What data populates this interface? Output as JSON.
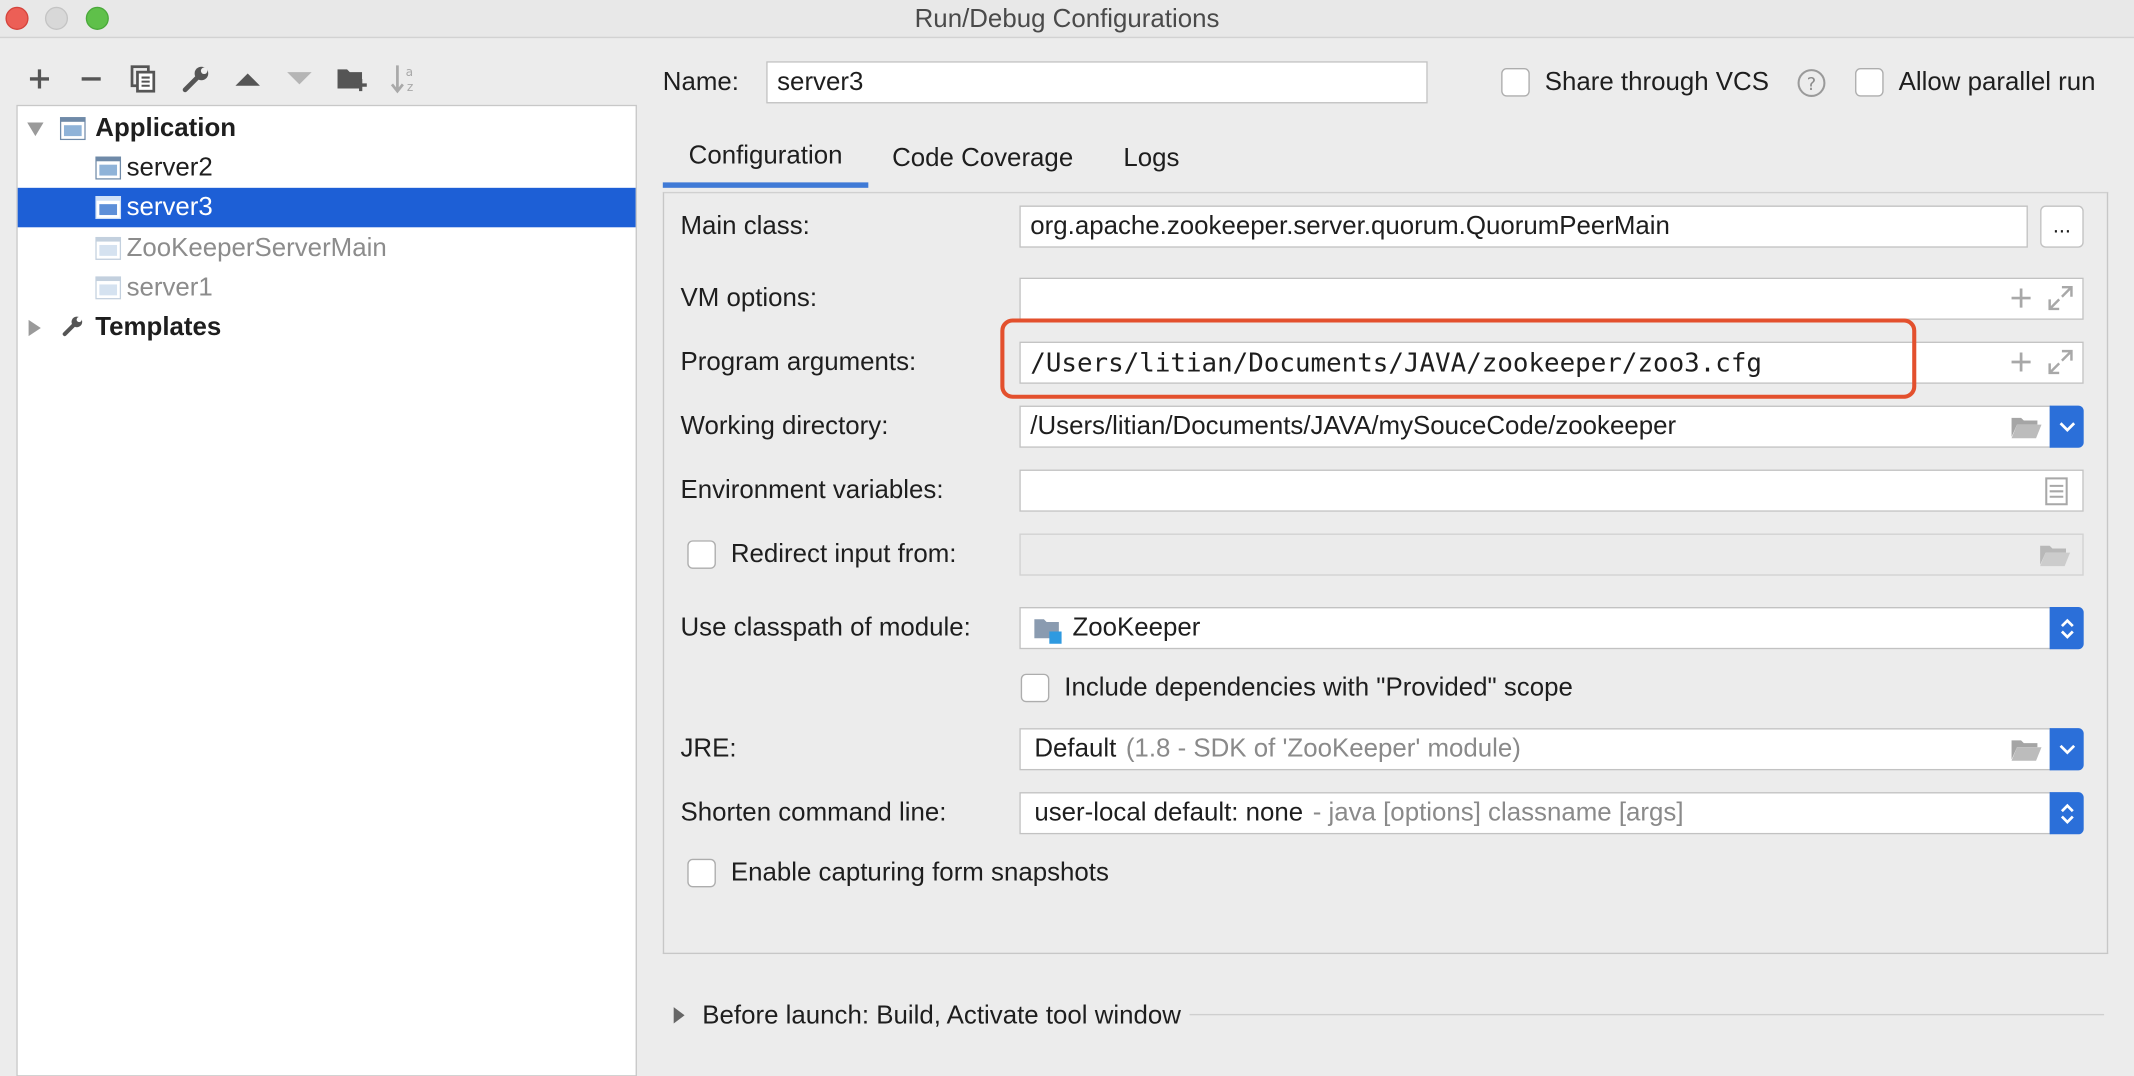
{
  "window": {
    "title": "Run/Debug Configurations"
  },
  "toolbar": {
    "buttons": [
      "add-icon",
      "remove-icon",
      "copy-icon",
      "wrench-icon",
      "move-up-icon",
      "move-down-icon",
      "folder-add-icon",
      "sort-icon"
    ]
  },
  "tree": {
    "group_label": "Application",
    "items": [
      {
        "label": "server2",
        "selected": false,
        "dim": false
      },
      {
        "label": "server3",
        "selected": true,
        "dim": false
      },
      {
        "label": "ZooKeeperServerMain",
        "selected": false,
        "dim": true
      },
      {
        "label": "server1",
        "selected": false,
        "dim": true
      }
    ],
    "templates_label": "Templates"
  },
  "header": {
    "name_label": "Name:",
    "name_value": "server3",
    "share_label": "Share through VCS",
    "share_checked": false,
    "parallel_label": "Allow parallel run",
    "parallel_checked": false
  },
  "tabs": [
    {
      "label": "Configuration",
      "active": true
    },
    {
      "label": "Code Coverage",
      "active": false
    },
    {
      "label": "Logs",
      "active": false
    }
  ],
  "config": {
    "main_class_label": "Main class:",
    "main_class_value": "org.apache.zookeeper.server.quorum.QuorumPeerMain",
    "main_class_browse": "...",
    "vm_options_label": "VM options:",
    "vm_options_value": "",
    "program_args_label": "Program arguments:",
    "program_args_value": "/Users/litian/Documents/JAVA/zookeeper/zoo3.cfg",
    "working_dir_label": "Working directory:",
    "working_dir_value": "/Users/litian/Documents/JAVA/mySouceCode/zookeeper",
    "env_vars_label": "Environment variables:",
    "env_vars_value": "",
    "redirect_label": "Redirect input from:",
    "redirect_checked": false,
    "classpath_label": "Use classpath of module:",
    "classpath_value": "ZooKeeper",
    "include_deps_label": "Include dependencies with \"Provided\" scope",
    "include_deps_checked": false,
    "jre_label": "JRE:",
    "jre_value": "Default",
    "jre_detail": "(1.8 - SDK of 'ZooKeeper' module)",
    "shorten_label": "Shorten command line:",
    "shorten_value": "user-local default: none",
    "shorten_detail": "- java [options] classname [args]",
    "snapshots_label": "Enable capturing form snapshots",
    "snapshots_checked": false
  },
  "before_launch": {
    "label": "Before launch: Build, Activate tool window"
  },
  "colors": {
    "selection": "#1d5fd6",
    "accent": "#2b6fd9",
    "highlight_box": "#e3502d"
  }
}
